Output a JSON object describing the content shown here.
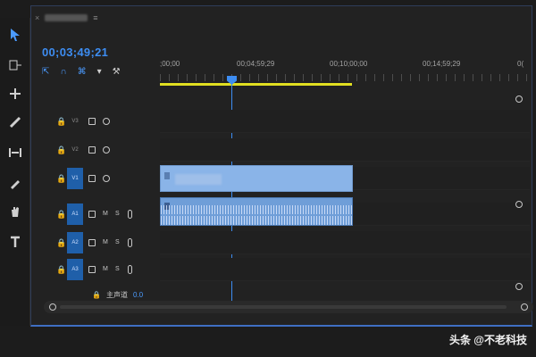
{
  "timeline": {
    "timecode": "00;03;49;21",
    "ruler_labels": [
      ";00;00",
      "00;04;59;29",
      "00;10;00;00",
      "00;14;59;29",
      "0("
    ],
    "tracks": {
      "video": [
        "V3",
        "V2",
        "V1"
      ],
      "audio": [
        "A1",
        "A2",
        "A3"
      ]
    },
    "master": {
      "label": "主声道",
      "value": "0.0"
    }
  },
  "watermark": "头条 @不老科技"
}
